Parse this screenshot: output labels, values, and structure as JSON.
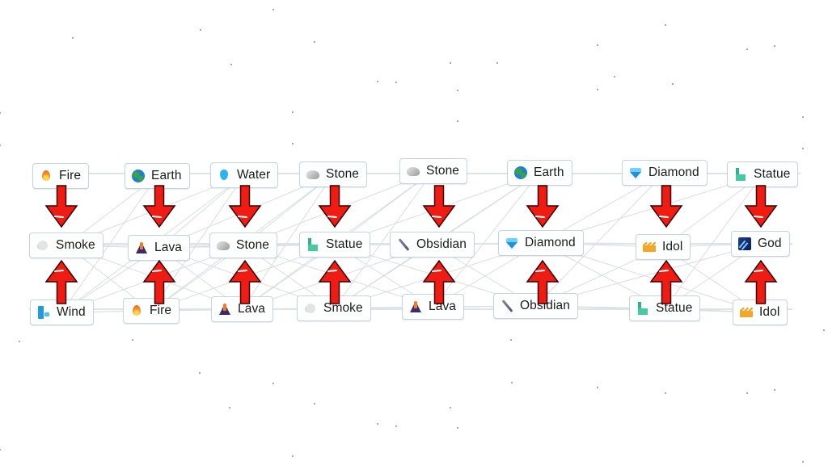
{
  "canvas": {
    "title": "Infinite Craft recipe chain",
    "background": "#ffffff",
    "arrow_color": "#ee1c12",
    "arrow_outline": "#3a0000"
  },
  "columns": [
    {
      "top": {
        "icon": "fire-icon",
        "label": "Fire"
      },
      "result": {
        "icon": "smoke-icon",
        "label": "Smoke"
      },
      "bottom": {
        "icon": "wind-icon",
        "label": "Wind"
      }
    },
    {
      "top": {
        "icon": "earth-icon",
        "label": "Earth"
      },
      "result": {
        "icon": "lava-icon",
        "label": "Lava"
      },
      "bottom": {
        "icon": "fire-icon",
        "label": "Fire"
      }
    },
    {
      "top": {
        "icon": "water-icon",
        "label": "Water"
      },
      "result": {
        "icon": "stone-icon",
        "label": "Stone"
      },
      "bottom": {
        "icon": "lava-icon",
        "label": "Lava"
      }
    },
    {
      "top": {
        "icon": "stone-icon",
        "label": "Stone"
      },
      "result": {
        "icon": "statue-icon",
        "label": "Statue"
      },
      "bottom": {
        "icon": "smoke-icon",
        "label": "Smoke"
      }
    },
    {
      "top": {
        "icon": "stone-icon",
        "label": "Stone"
      },
      "result": {
        "icon": "obsidian-icon",
        "label": "Obsidian"
      },
      "bottom": {
        "icon": "lava-icon",
        "label": "Lava"
      }
    },
    {
      "top": {
        "icon": "earth-icon",
        "label": "Earth"
      },
      "result": {
        "icon": "diamond-icon",
        "label": "Diamond"
      },
      "bottom": {
        "icon": "obsidian-icon",
        "label": "Obsidian"
      }
    },
    {
      "top": {
        "icon": "diamond-icon",
        "label": "Diamond"
      },
      "result": {
        "icon": "idol-icon",
        "label": "Idol"
      },
      "bottom": {
        "icon": "statue-icon",
        "label": "Statue"
      }
    },
    {
      "top": {
        "icon": "statue-icon",
        "label": "Statue"
      },
      "result": {
        "icon": "god-icon",
        "label": "God"
      },
      "bottom": {
        "icon": "idol-icon",
        "label": "Idol"
      }
    }
  ]
}
